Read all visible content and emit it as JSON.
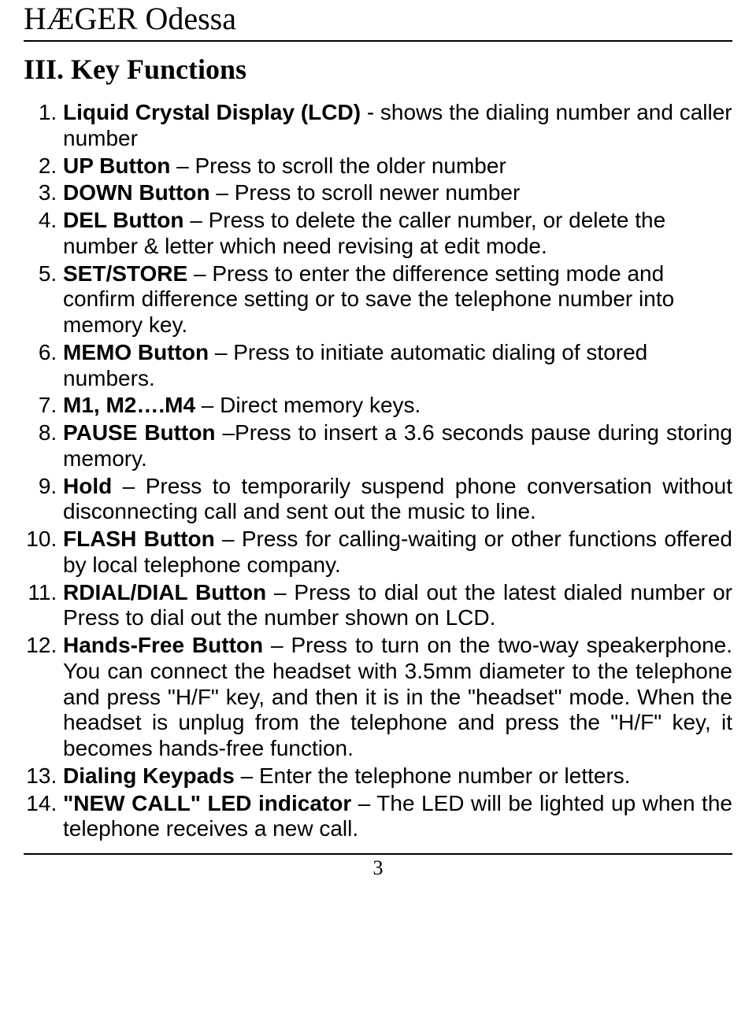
{
  "header": {
    "title": "HÆGER Odessa"
  },
  "section": {
    "heading": "III. Key Functions"
  },
  "items": [
    {
      "label": "Liquid Crystal Display (LCD)",
      "desc": " - shows the dialing number and caller number"
    },
    {
      "label": "UP Button",
      "desc": " – Press to scroll the older number"
    },
    {
      "label": "DOWN Button",
      "desc": " – Press to scroll newer number"
    },
    {
      "label": "DEL Button",
      "desc": " – Press to delete the caller number, or delete the number & letter which need revising at edit mode."
    },
    {
      "label": "SET/STORE",
      "desc": " – Press to enter the difference setting mode and confirm difference setting or to save the telephone number into memory key."
    },
    {
      "label": "MEMO Button",
      "desc": " – Press to initiate automatic dialing of stored numbers."
    },
    {
      "label": "M1, M2….M4",
      "desc": " – Direct memory keys."
    },
    {
      "label": "PAUSE Button",
      "desc": " –Press to insert a 3.6 seconds pause during storing memory."
    },
    {
      "label": "Hold",
      "desc": " – Press to temporarily suspend phone conversation without disconnecting call and sent out the music to line."
    },
    {
      "label": "FLASH Button",
      "desc": " – Press for calling-waiting or other functions offered by local telephone company."
    },
    {
      "label": "RDIAL/DIAL Button",
      "desc": " – Press to dial out the latest dialed number or Press to dial out the number shown on LCD."
    },
    {
      "label": "Hands-Free Button",
      "desc": " – Press to turn on the two-way speakerphone. You can connect the headset with 3.5mm diameter to the telephone and press \"H/F\" key, and then it is in the \"headset\" mode. When the headset is unplug from the telephone and press the \"H/F\" key, it becomes hands-free function."
    },
    {
      "label": "Dialing Keypads",
      "desc": " – Enter the telephone number or letters."
    },
    {
      "label": "\"NEW CALL\" LED indicator",
      "desc": " – The LED will be lighted up when the telephone receives a new call."
    }
  ],
  "footer": {
    "page_number": "3"
  }
}
